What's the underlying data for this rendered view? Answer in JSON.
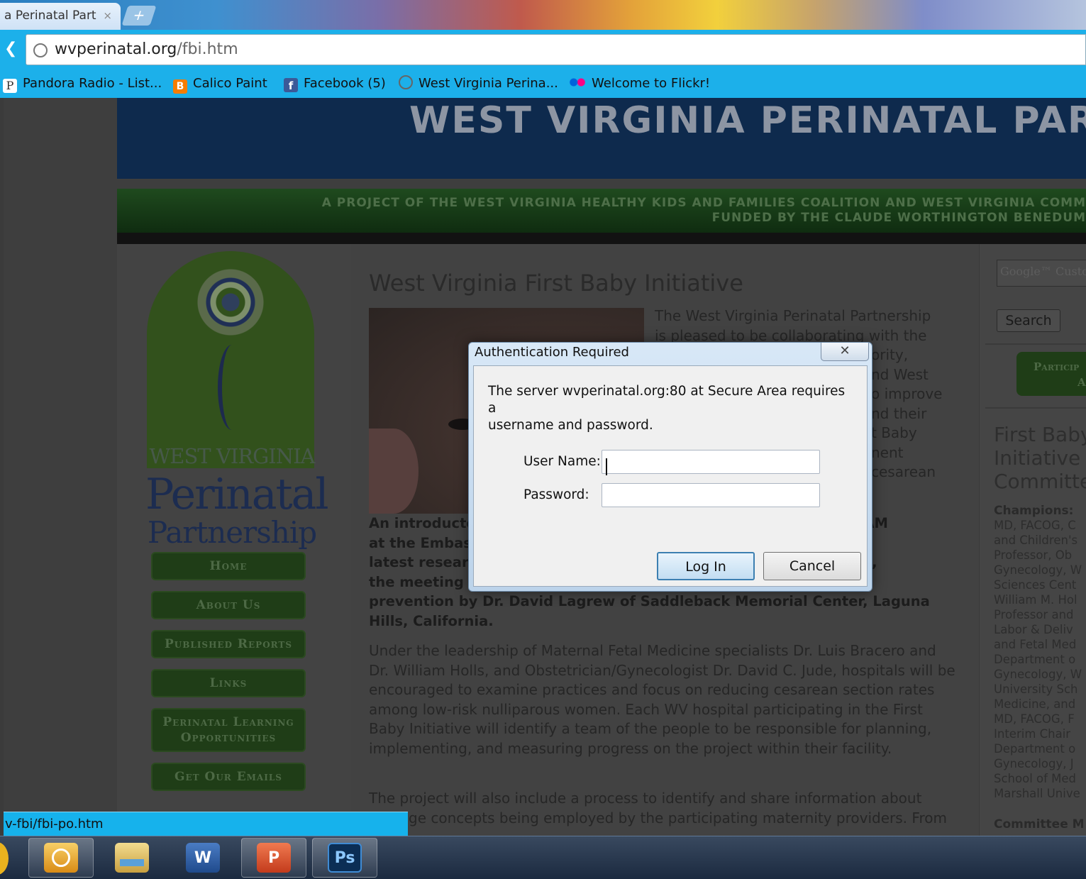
{
  "browser": {
    "tab_title": "a Perinatal Part",
    "tab_close": "×",
    "new_tab": "+",
    "url_domain": "wvperinatal.org",
    "url_path": "/fbi.htm",
    "bookmarks": [
      {
        "label": "Pandora Radio - List...",
        "icon": "pandora-icon",
        "color": "#ffffff"
      },
      {
        "label": "Calico Paint",
        "icon": "blogger-icon",
        "color": "#f57d00"
      },
      {
        "label": "Facebook (5)",
        "icon": "facebook-icon",
        "color": "#3b5998"
      },
      {
        "label": "West Virginia Perina...",
        "icon": "globe-icon",
        "color": "#cccccc"
      },
      {
        "label": "Welcome to Flickr!",
        "icon": "flickr-icon",
        "color": "#ff0084"
      }
    ],
    "status_url": "v-fbi/fbi-po.htm"
  },
  "site": {
    "title": "WEST VIRGINIA PERINATAL PARTNE",
    "tagline_1": "A PROJECT OF THE WEST VIRGINIA HEALTHY KIDS AND FAMILIES COALITION AND WEST VIRGINIA COMM",
    "tagline_2": "FUNDED BY THE  CLAUDE WORTHINGTON BENEDUM",
    "logo_wv": "WEST VIRGINIA",
    "logo_perinatal": "Perinatal",
    "logo_partnership": "Partnership",
    "nav": [
      "Home",
      "About Us",
      "Published Reports",
      "Links",
      "Perinatal Learning Opportunities",
      "Get Our Emails"
    ]
  },
  "article": {
    "title": "West Virginia First Baby Initiative",
    "intro_right": "The West Virginia Perinatal Partnership is pleased to be collaborating with the ... ority, ... nd West ... o improve ... nd their ... t Baby ... ment ... cesarean",
    "intro_lines": [
      "The West Virginia Perinatal Partnership",
      "is pleased to be collaborating with the",
      "ority,",
      "nd West",
      "o improve",
      "nd their",
      "t Baby",
      "nent",
      "cesarean"
    ],
    "bold_lines": [
      "An introducto                                                                      t 9:00 AM",
      "at the Embas                                                                          n the",
      "latest resear                                                                      utcomes,",
      "the meeting v                                                                  erm birth",
      "prevention by Dr. David Lagrew of Saddleback Memorial Center, Laguna",
      "Hills, California."
    ],
    "para1": "Under the leadership of Maternal Fetal Medicine specialists Dr. Luis Bracero and Dr. William Holls, and Obstetrician/Gynecologist Dr. David C. Jude, hospitals will be encouraged to examine practices and focus on reducing cesarean section rates among low-risk nulliparous women. Each WV hospital participating in the First Baby Initiative will identify a team of the people to be responsible for planning, implementing, and measuring progress on the project within their facility.",
    "para2": "The project will also include a process to identify and share information about",
    "para2b": "ge concepts being employed by the participating maternity providers. From"
  },
  "sidebar": {
    "search_placeholder": "Google™ Custo",
    "search_button": "Search",
    "participate_button_1": "Particip",
    "participate_button_2": "A",
    "fbi_title": "First Baby\nInitiative\nCommitte",
    "champions_label": "Champions:",
    "champions_text": "MD, FACOG, C\nand Children's\nProfessor, Ob\nGynecology, W\nSciences Cent\nWilliam M. Hol\nProfessor and\nLabor & Deliv\nand Fetal Med\nDepartment o\nGynecology, W\nUniversity Sch\nMedicine, and\nMD, FACOG, F\nInterim Chair\nDepartment o\nGynecology, J\nSchool of Med\nMarshall Unive",
    "committee_label": "Committee M"
  },
  "dialog": {
    "title": "Authentication Required",
    "close": "✕",
    "message": "The server wvperinatal.org:80 at Secure Area requires a\nusername and password.",
    "username_label": "User Name:",
    "username_value": "",
    "password_label": "Password:",
    "password_value": "",
    "login_button": "Log In",
    "cancel_button": "Cancel"
  },
  "taskbar": {
    "apps": [
      {
        "name": "outlook",
        "glyph": "",
        "color": "#e8a21c"
      },
      {
        "name": "file-explorer",
        "glyph": "",
        "color": "#e6c36a"
      },
      {
        "name": "word",
        "glyph": "W",
        "color": "#2a5699"
      },
      {
        "name": "powerpoint",
        "glyph": "P",
        "color": "#d24726"
      },
      {
        "name": "photoshop",
        "glyph": "Ps",
        "color": "#0b2e55"
      }
    ]
  }
}
